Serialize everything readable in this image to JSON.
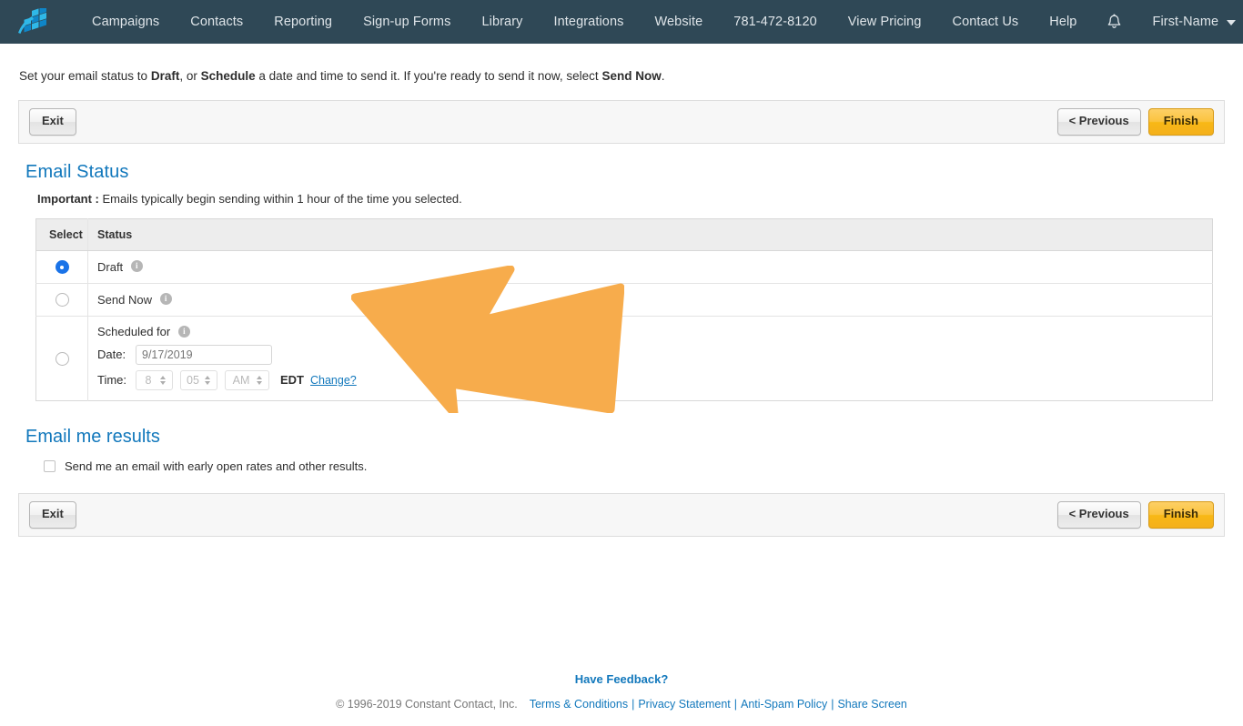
{
  "nav": {
    "logo_name": "constant-contact-logo",
    "items": [
      {
        "label": "Campaigns"
      },
      {
        "label": "Contacts"
      },
      {
        "label": "Reporting"
      },
      {
        "label": "Sign-up Forms"
      },
      {
        "label": "Library"
      },
      {
        "label": "Integrations"
      },
      {
        "label": "Website"
      },
      {
        "label": "781-472-8120"
      },
      {
        "label": "View Pricing"
      },
      {
        "label": "Contact Us"
      },
      {
        "label": "Help"
      }
    ],
    "bell_icon": "notification-bell-icon",
    "account": "First-Name",
    "background": "#2f4856"
  },
  "intro": {
    "part1": "Set your email status to ",
    "bold1": "Draft",
    "part2": ", or ",
    "bold2": "Schedule",
    "part3": " a date and time to send it. If you're ready to send it now, select ",
    "bold3": "Send Now",
    "part4": "."
  },
  "toolbar": {
    "exit_label": "Exit",
    "previous_label": "< Previous",
    "finish_label": "Finish",
    "finish_color": "#f8b816"
  },
  "email_status": {
    "title": "Email Status",
    "important_label": "Important :",
    "important_text": " Emails typically begin sending within 1 hour of the time you selected.",
    "columns": [
      "Select",
      "Status"
    ],
    "rows": [
      {
        "label": "Draft",
        "selected": true,
        "info_icon": "info-icon"
      },
      {
        "label": "Send Now",
        "selected": false,
        "info_icon": "info-icon"
      }
    ],
    "scheduled": {
      "heading": "Scheduled for",
      "info_icon": "info-icon",
      "selected": false,
      "date_label": "Date:",
      "date_value": "9/17/2019",
      "time_label": "Time:",
      "hour": "8",
      "minute": "05",
      "meridiem": "AM",
      "timezone": "EDT",
      "change_link": "Change?"
    }
  },
  "email_results": {
    "title": "Email me results",
    "checkbox_label": "Send me an email with early open rates and other results.",
    "checked": false
  },
  "annotation": {
    "name": "orange-arrow-pointing-left",
    "color": "#f7ac4c"
  },
  "footer": {
    "feedback": "Have Feedback?",
    "copyright": "© 1996-2019 Constant Contact, Inc.",
    "links": [
      "Terms & Conditions",
      "Privacy Statement",
      "Anti-Spam Policy",
      "Share Screen"
    ],
    "separator": "|"
  }
}
